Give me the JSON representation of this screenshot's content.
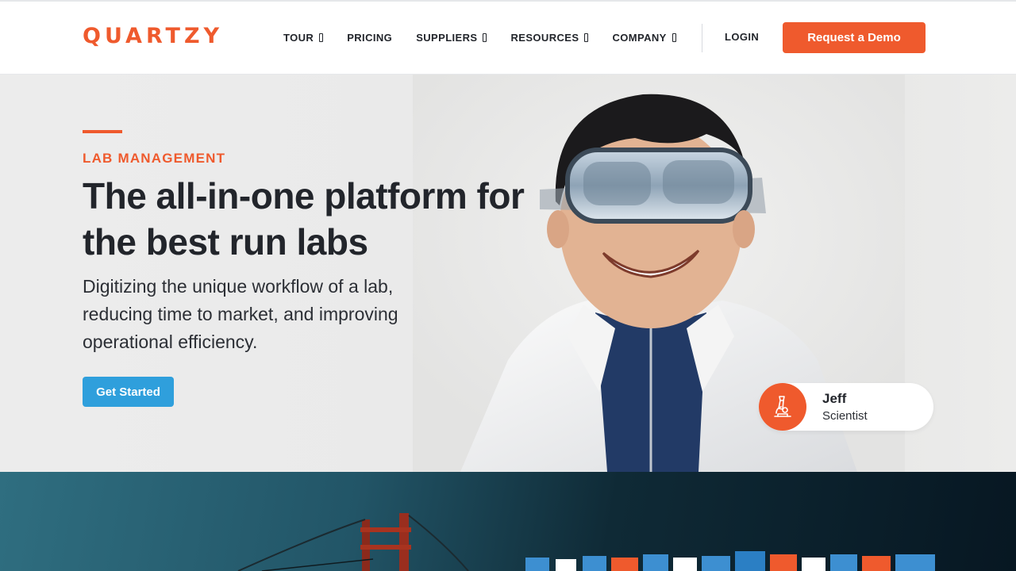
{
  "header": {
    "logo": "QUARTZY",
    "nav": [
      {
        "label": "TOUR",
        "dropdown": true
      },
      {
        "label": "PRICING",
        "dropdown": false
      },
      {
        "label": "SUPPLIERS",
        "dropdown": true
      },
      {
        "label": "RESOURCES",
        "dropdown": true
      },
      {
        "label": "COMPANY",
        "dropdown": true
      }
    ],
    "login": "LOGIN",
    "demo_button": "Request a Demo"
  },
  "hero": {
    "eyebrow": "LAB MANAGEMENT",
    "headline": "The all-in-one platform for the best run labs",
    "subtext": "Digitizing the unique workflow of a lab, reducing time to market, and improving operational efficiency.",
    "cta": "Get Started",
    "person": {
      "name": "Jeff",
      "role": "Scientist",
      "icon": "microscope-icon"
    }
  },
  "colors": {
    "brand_orange": "#ef5a2d",
    "cta_blue": "#2f9fdc",
    "text_dark": "#22252b"
  }
}
